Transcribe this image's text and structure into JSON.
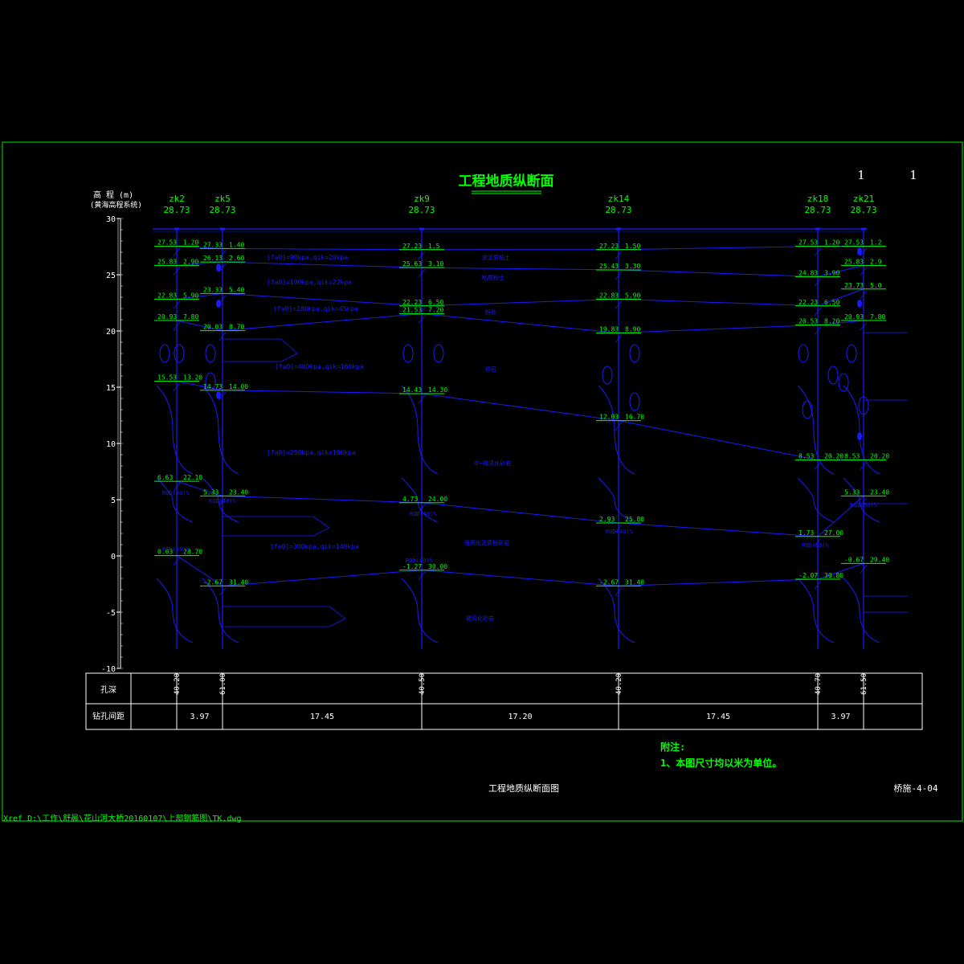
{
  "title": "工程地质纵断面",
  "sheet": {
    "left": "1",
    "right": "1"
  },
  "axis": {
    "label1": "高 程 (m)",
    "label2": "(黄海高程系统)",
    "ticks": [
      "30",
      "25",
      "20",
      "15",
      "10",
      "5",
      "0",
      "-5",
      "-10"
    ]
  },
  "boreholes": [
    {
      "name": "zk2",
      "top": "28.73",
      "station": "40.20"
    },
    {
      "name": "zk5",
      "top": "28.73",
      "station": "61.00"
    },
    {
      "name": "zk9",
      "top": "28.73",
      "station": "40.50"
    },
    {
      "name": "zk14",
      "top": "28.73",
      "station": "40.20"
    },
    {
      "name": "zk18",
      "top": "28.73",
      "station": "40.70"
    },
    {
      "name": "zk21",
      "top": "28.73",
      "station": "61.50"
    }
  ],
  "layer_labels": [
    {
      "text": "[fa0]=90kpa,qik=20kpa"
    },
    {
      "text": "[fa0]=100kpa,qik=22kpa"
    },
    {
      "text": "[fa0]=180kpa,qik=45kpa"
    },
    {
      "text": "[fa0]=400kpa,qik=160kpa"
    },
    {
      "text": "[fa0]=250kpa,qik=100kpa"
    },
    {
      "text": "[fa0]=300kpa,qik=140kpa"
    }
  ],
  "stratum_names": [
    "淤泥质粘土",
    "粘质粉土",
    "粉砂",
    "卵石",
    "中~微风化砂岩",
    "强风化泥质粉砂岩",
    "微风化砂岩"
  ],
  "depth_values": {
    "zk2": [
      [
        "27.53",
        "1.20"
      ],
      [
        "25.83",
        "2.90"
      ],
      [
        "22.83",
        "5.90"
      ],
      [
        "20.93",
        "7.80"
      ],
      [
        "15.53",
        "13.20"
      ],
      [
        "6.63",
        "22.10"
      ],
      [
        "0.03",
        "28.70"
      ]
    ],
    "zk5": [
      [
        "27.33",
        "1.40"
      ],
      [
        "26.13",
        "2.60"
      ],
      [
        "23.33",
        "5.40"
      ],
      [
        "20.03",
        "8.70"
      ],
      [
        "14.73",
        "14.00"
      ],
      [
        "5.33",
        "23.40"
      ],
      [
        "-2.67",
        "31.40"
      ]
    ],
    "zk9": [
      [
        "27.23",
        "1.5"
      ],
      [
        "25.63",
        "3.10"
      ],
      [
        "22.23",
        "6.50"
      ],
      [
        "21.53",
        "7.20"
      ],
      [
        "14.43",
        "14.30"
      ],
      [
        "4.73",
        "24.00"
      ],
      [
        "-1.27",
        "30.00"
      ]
    ],
    "zk14": [
      [
        "27.23",
        "1.50"
      ],
      [
        "25.43",
        "3.30"
      ],
      [
        "22.83",
        "5.90"
      ],
      [
        "19.83",
        "8.90"
      ],
      [
        "12.03",
        "16.70"
      ],
      [
        "2.93",
        "25.80"
      ],
      [
        "-2.67",
        "31.40"
      ]
    ],
    "zk18": [
      [
        "27.53",
        "1.20"
      ],
      [
        "24.83",
        "3.90"
      ],
      [
        "22.23",
        "6.50"
      ],
      [
        "20.53",
        "8.20"
      ],
      [
        "8.53",
        "20.20"
      ],
      [
        "1.73",
        "27.00"
      ],
      [
        "-2.07",
        "30.80"
      ]
    ],
    "zk21": [
      [
        "27.53",
        "1.2"
      ],
      [
        "25.83",
        "2.9"
      ],
      [
        "23.73",
        "5.0"
      ],
      [
        "20.93",
        "7.80"
      ],
      [
        "8.53",
        "20.20"
      ],
      [
        "5.33",
        "23.40"
      ],
      [
        "-0.67",
        "29.40"
      ]
    ]
  },
  "sample_labels": [
    "RQD(30)%",
    "RQD(30)%",
    "RQD(40)%",
    "RQD(40)%",
    "RQD(40)%",
    "RQD(40)%",
    "RQD(30)%",
    "RQD(50)%"
  ],
  "table": {
    "row1_label": "孔深",
    "row2_label": "钻孔间距",
    "spacings": [
      "3.97",
      "17.45",
      "17.20",
      "17.45",
      "3.97"
    ]
  },
  "notes": {
    "title": "附注:",
    "line1": "1、本图尺寸均以米为单位。"
  },
  "drawing_title": "工程地质纵断面图",
  "drawing_no": "桥施-4-04",
  "xref": "Xref D:\\工作\\舒晨\\花山河大桥20160107\\上部钢筋图\\TK.dwg",
  "colors": {
    "frame": "#00c800",
    "blue": "#1a1aff",
    "green": "#00ff00",
    "white": "#ffffff",
    "title": "#00ff00"
  }
}
